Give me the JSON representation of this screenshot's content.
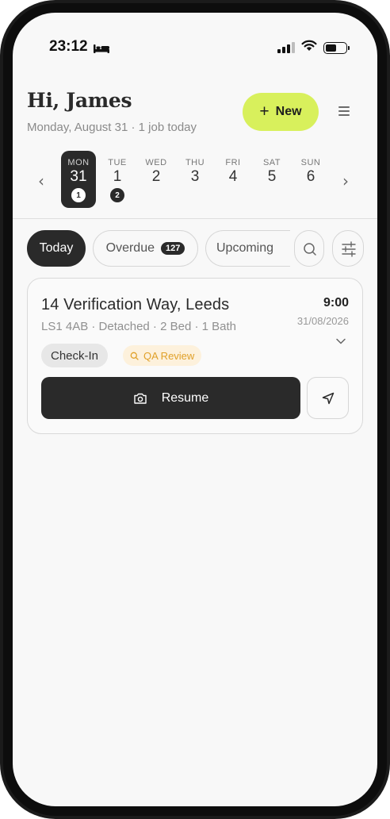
{
  "status_bar": {
    "time": "23:12",
    "icons": [
      "bed-icon",
      "signal-icon",
      "wifi-icon",
      "battery-icon"
    ]
  },
  "header": {
    "greeting": "Hi, James",
    "subline": "Monday, August 31 · 1 job today",
    "new_button_label": "New",
    "menu_icon": "menu-icon"
  },
  "week": {
    "days": [
      {
        "name": "MON",
        "num": "31",
        "badge": "1",
        "selected": true
      },
      {
        "name": "TUE",
        "num": "1",
        "badge": "2",
        "selected": false
      },
      {
        "name": "WED",
        "num": "2",
        "badge": "",
        "selected": false
      },
      {
        "name": "THU",
        "num": "3",
        "badge": "",
        "selected": false
      },
      {
        "name": "FRI",
        "num": "4",
        "badge": "",
        "selected": false
      },
      {
        "name": "SAT",
        "num": "5",
        "badge": "",
        "selected": false
      },
      {
        "name": "SUN",
        "num": "6",
        "badge": "",
        "selected": false
      }
    ]
  },
  "filters": {
    "today_label": "Today",
    "overdue_label": "Overdue",
    "overdue_count": "127",
    "upcoming_label": "Upcoming"
  },
  "job": {
    "address": "14 Verification Way, Leeds",
    "details": "LS1 4AB · Detached · 2 Bed · 1 Bath",
    "time": "9:00",
    "date": "31/08/2026",
    "type_tag": "Check-In",
    "status_tag": "QA Review",
    "resume_label": "Resume"
  },
  "colors": {
    "accent": "#d8f05c",
    "dark": "#2a2a2a",
    "qa_text": "#e0a028",
    "qa_bg": "#fdf1dc"
  }
}
